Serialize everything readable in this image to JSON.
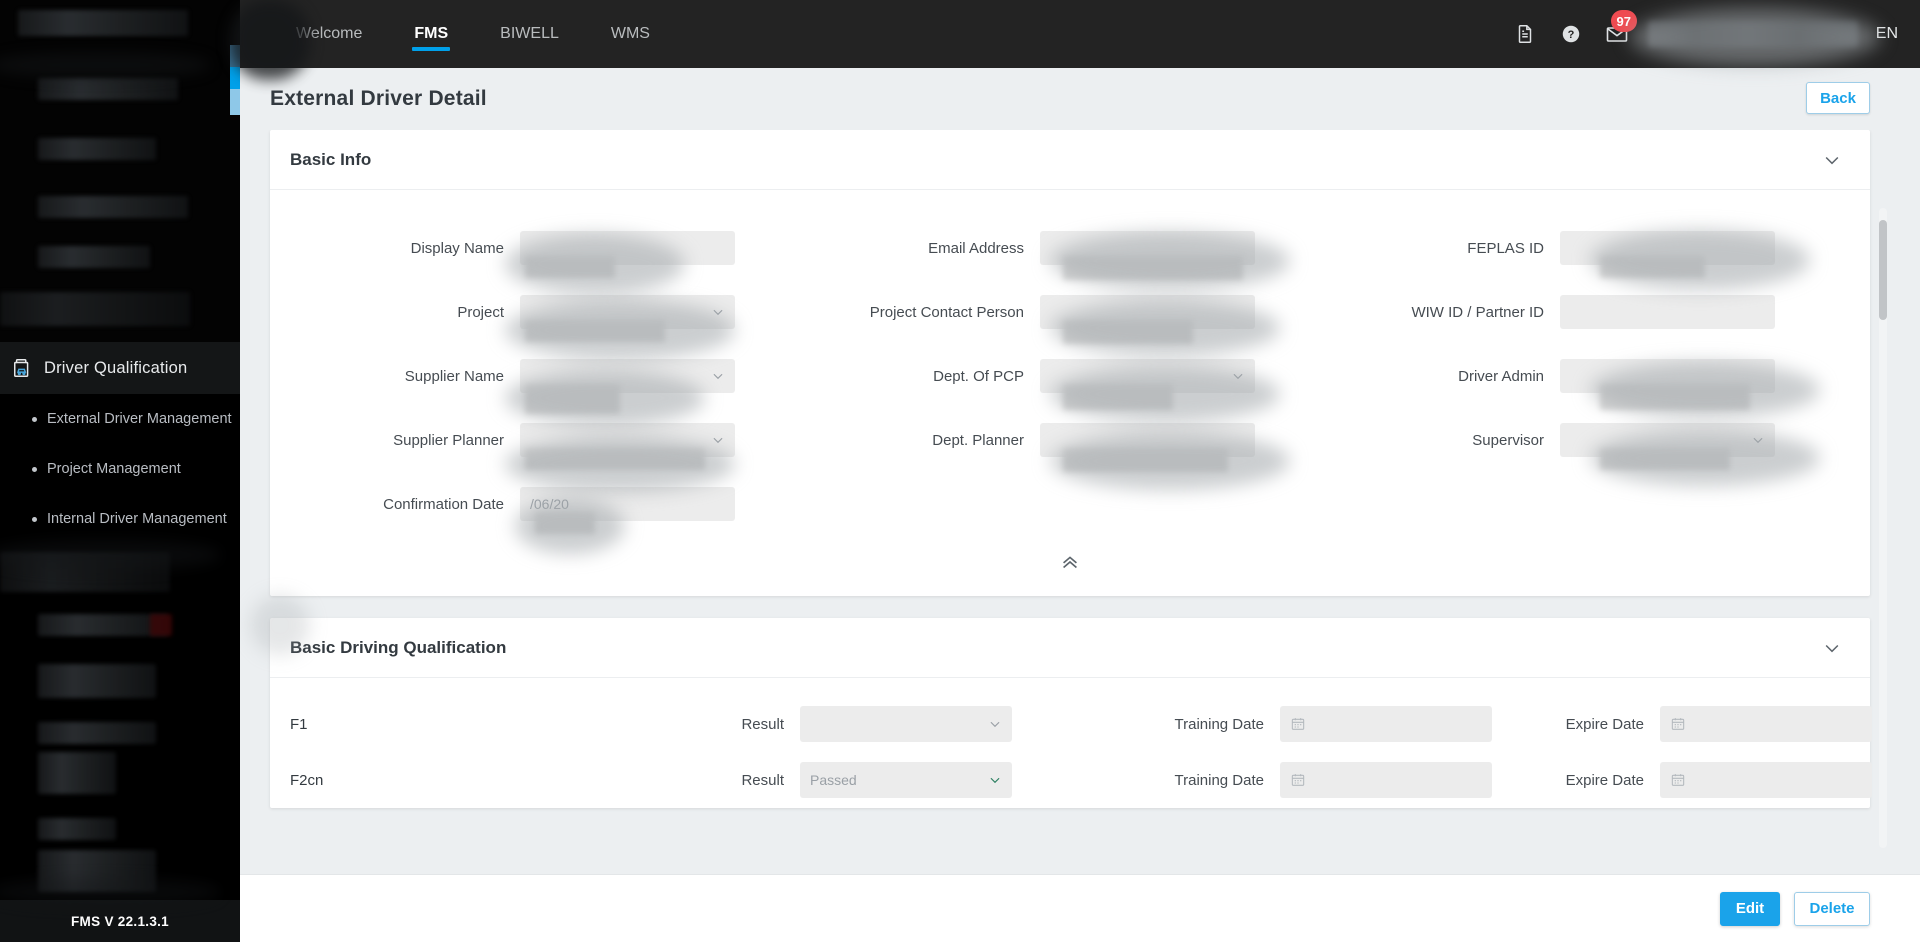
{
  "topnav": {
    "tabs": [
      {
        "label": "Welcome",
        "active": false
      },
      {
        "label": "FMS",
        "active": true
      },
      {
        "label": "BIWELL",
        "active": false
      },
      {
        "label": "WMS",
        "active": false
      }
    ],
    "icons": [
      {
        "name": "document-icon"
      },
      {
        "name": "help-icon"
      },
      {
        "name": "mail-icon"
      }
    ],
    "mail_badge": "97",
    "language": "EN",
    "accent_color": "#00a0e9",
    "bar_color": "#232323",
    "badge_color": "#ef4b51"
  },
  "sidebar": {
    "section": {
      "label": "Driver Qualification",
      "icon": "clipboard-car-icon"
    },
    "items": [
      {
        "label": "External Driver Management"
      },
      {
        "label": "Project Management"
      },
      {
        "label": "Internal Driver Management"
      }
    ],
    "version": "FMS V 22.1.3.1",
    "background": "#000000"
  },
  "page": {
    "title": "External Driver Detail",
    "back_label": "Back"
  },
  "basic_info": {
    "title": "Basic Info",
    "collapse_icon": "chevron-down-icon",
    "collapse_all_icon": "double-chevron-up-icon",
    "fields": [
      {
        "label": "Display Name",
        "value": "",
        "type": "text",
        "col": 1
      },
      {
        "label": "Email Address",
        "value": "",
        "type": "text",
        "col": 2
      },
      {
        "label": "FEPLAS ID",
        "value": "",
        "type": "text",
        "col": 3
      },
      {
        "label": "Project",
        "value": "",
        "type": "select",
        "col": 1
      },
      {
        "label": "Project Contact Person",
        "value": "",
        "type": "text",
        "col": 2
      },
      {
        "label": "WIW ID / Partner ID",
        "value": "",
        "type": "text",
        "col": 3
      },
      {
        "label": "Supplier Name",
        "value": "",
        "type": "select",
        "col": 1
      },
      {
        "label": "Dept. Of PCP",
        "value": "",
        "type": "select",
        "col": 2
      },
      {
        "label": "Driver Admin",
        "value": "",
        "type": "text",
        "col": 3
      },
      {
        "label": "Supplier Planner",
        "value": "",
        "type": "select",
        "col": 1
      },
      {
        "label": "Dept. Planner",
        "value": "",
        "type": "text",
        "col": 2
      },
      {
        "label": "Supervisor",
        "value": "",
        "type": "select",
        "col": 3
      },
      {
        "label": "Confirmation Date",
        "value": "/06/20",
        "type": "text",
        "col": 1
      }
    ]
  },
  "driving_qualification": {
    "title": "Basic Driving Qualification",
    "collapse_icon": "chevron-down-icon",
    "result_label": "Result",
    "training_date_label": "Training Date",
    "expire_date_label": "Expire Date",
    "rows": [
      {
        "code": "F1",
        "result": "",
        "result_state": "empty",
        "training_date": "",
        "expire_date": ""
      },
      {
        "code": "F2cn",
        "result": "Passed",
        "result_state": "passed",
        "training_date": "",
        "expire_date": ""
      }
    ],
    "passed_color": "#4ed0a0"
  },
  "footer": {
    "edit_label": "Edit",
    "delete_label": "Delete",
    "primary_color": "#1aa3ea"
  }
}
